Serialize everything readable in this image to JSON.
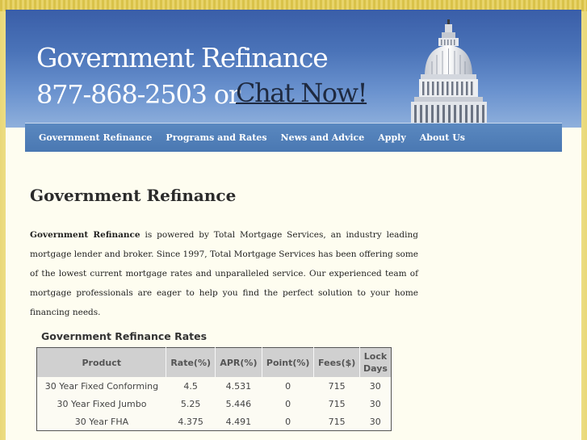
{
  "header": {
    "title": "Government Refinance",
    "phone": "877-868-2503 or",
    "chat_label": "Chat Now!"
  },
  "nav": {
    "items": [
      "Government Refinance",
      "Programs and Rates",
      "News and Advice",
      "Apply",
      "About Us"
    ]
  },
  "main": {
    "title": "Government Refinance",
    "intro_bold": "Government Refinance",
    "intro_text": " is powered by Total Mortgage Services, an industry leading mortgage lender and broker. Since 1997, Total Mortgage Services has been offering some of the lowest current mortgage rates and unparalleled service. Our experienced team of mortgage professionals are eager to help you find the perfect solution to your home financing needs."
  },
  "rates": {
    "title": "Government Refinance Rates",
    "columns": [
      "Product",
      "Rate(%)",
      "APR(%)",
      "Point(%)",
      "Fees($)",
      "Lock Days"
    ],
    "rows": [
      [
        "30 Year Fixed Conforming",
        "4.5",
        "4.531",
        "0",
        "715",
        "30"
      ],
      [
        "30 Year Fixed Jumbo",
        "5.25",
        "5.446",
        "0",
        "715",
        "30"
      ],
      [
        "30 Year FHA",
        "4.375",
        "4.491",
        "0",
        "715",
        "30"
      ]
    ]
  },
  "colors": {
    "header_blue": "#3a5ea8",
    "nav_blue": "#4a78b2",
    "page_background": "#f6eeb6",
    "content_background": "#fefdf0"
  }
}
